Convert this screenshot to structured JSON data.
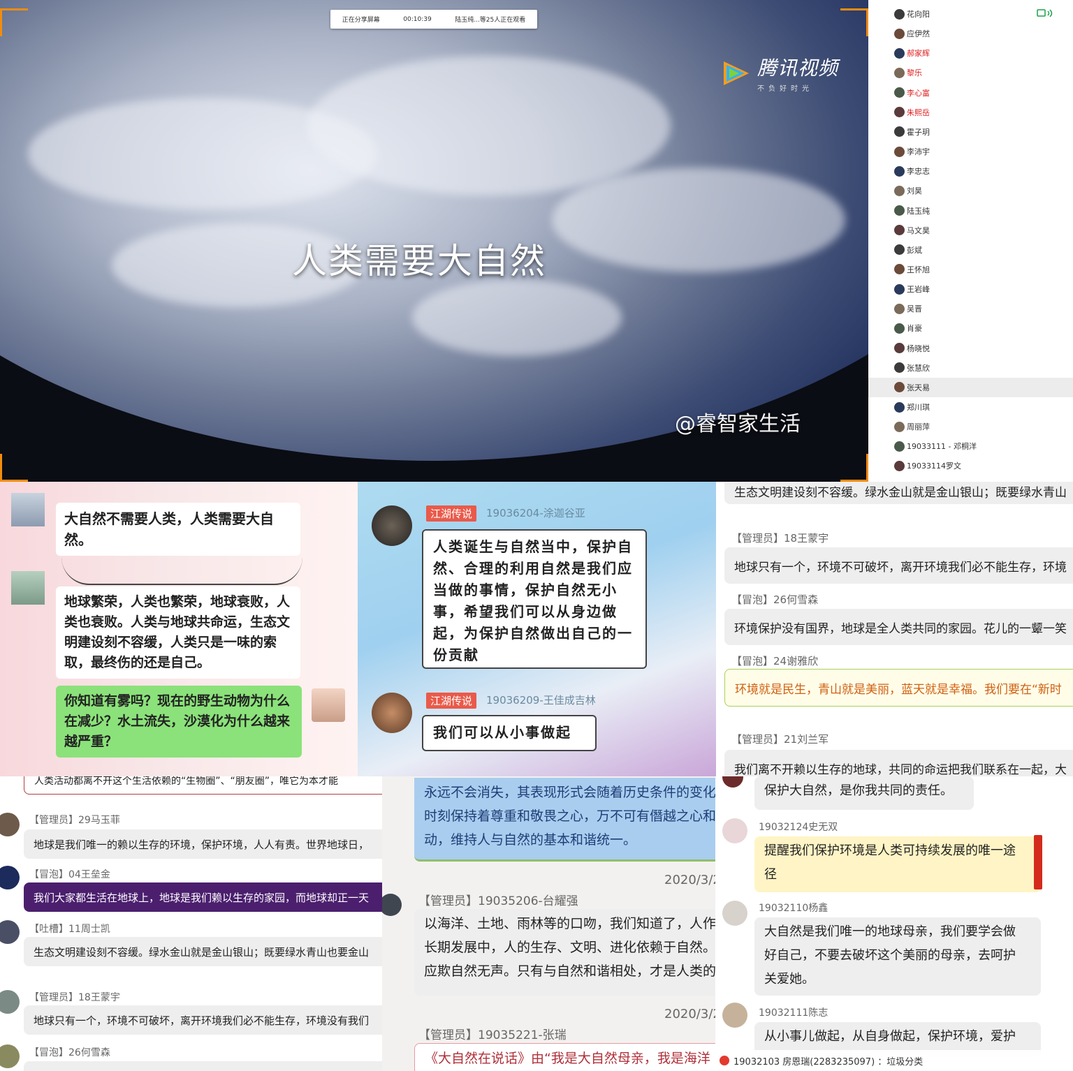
{
  "video": {
    "share_status": "正在分享屏幕",
    "share_time": "00:10:39",
    "viewers": "陆玉纯...等25人正在观看",
    "logo_text": "腾讯视频",
    "logo_slogan": "不负好时光",
    "caption": "人类需要大自然",
    "watermark": "@睿智家生活"
  },
  "members": {
    "items": [
      {
        "name": "花向阳",
        "color": "#333333"
      },
      {
        "name": "应伊然",
        "color": "#333333"
      },
      {
        "name": "郝家辉",
        "color": "#e02020"
      },
      {
        "name": "黎乐",
        "color": "#e02020"
      },
      {
        "name": "李心富",
        "color": "#e02020"
      },
      {
        "name": "朱熙岳",
        "color": "#e02020"
      },
      {
        "name": "霍子玥",
        "color": "#333333"
      },
      {
        "name": "李沛宇",
        "color": "#333333"
      },
      {
        "name": "李忠志",
        "color": "#333333"
      },
      {
        "name": "刘昊",
        "color": "#333333"
      },
      {
        "name": "陆玉纯",
        "color": "#333333"
      },
      {
        "name": "马文昊",
        "color": "#333333"
      },
      {
        "name": "彭斌",
        "color": "#333333"
      },
      {
        "name": "王怀旭",
        "color": "#333333"
      },
      {
        "name": "王岩峰",
        "color": "#333333"
      },
      {
        "name": "吴晋",
        "color": "#333333"
      },
      {
        "name": "肖豪",
        "color": "#333333"
      },
      {
        "name": "杨晓悦",
        "color": "#333333"
      },
      {
        "name": "张慧欣",
        "color": "#333333"
      },
      {
        "name": "张天易",
        "color": "#333333"
      },
      {
        "name": "郑川琪",
        "color": "#333333"
      },
      {
        "name": "周丽萍",
        "color": "#333333"
      },
      {
        "name": "19033111 - 邓桐洋",
        "color": "#333333"
      },
      {
        "name": "19033114罗文",
        "color": "#333333"
      }
    ]
  },
  "wechat": {
    "msg1": "大自然不需要人类，人类需要大自然。",
    "msg2": "地球繁荣，人类也繁荣，地球衰败，人类也衰败。人类与地球共命运，生态文明建设刻不容缓，人类只是一味的索取，最终伤的还是自己。",
    "msg3": "你知道有雾吗？现在的野生动物为什么在减少？水土流失，沙漠化为什么越来越严重？"
  },
  "comic": {
    "tag1": "江湖传说",
    "name1": "19036204-涂迦谷亚",
    "msg1": "人类诞生与自然当中，保护自然、合理的利用自然是我们应当做的事情，保护自然无小事，希望我们可以从身边做起，为保护自然做出自己的一份贡献",
    "tag2": "江湖传说",
    "name2": "19036209-王佳成吉林",
    "msg2": "我们可以从小事做起"
  },
  "p3": {
    "top_text": "生态文明建设刻不容缓。绿水金山就是金山银山；既要绿水青山",
    "items": [
      {
        "tag": "【管理员】18王蒙宇",
        "text": "地球只有一个，环境不可破坏，离开环境我们必不能生存，环境"
      },
      {
        "tag": "【冒泡】26何雪森",
        "text": "环境保护没有国界，地球是全人类共同的家园。花儿的一颦一笑"
      },
      {
        "tag": "【冒泡】24谢雅欣",
        "text": "环境就是民生，青山就是美丽，蓝天就是幸福。我们要在“新时"
      },
      {
        "tag": "【管理员】21刘兰军",
        "text": "我们离不开赖以生存的地球，共同的命运把我们联系在一起，大"
      }
    ]
  },
  "p4": {
    "top_text": "人类活动都离不开这个生活依赖的“生物圈”、“朋友圈”，唯它为本才能",
    "items": [
      {
        "tag": "【管理员】29马玉菲",
        "text": "地球是我们唯一的赖以生存的环境，保护环境，人人有责。世界地球日，"
      },
      {
        "tag": "【冒泡】04王垒金",
        "text": "我们大家都生活在地球上，地球是我们赖以生存的家园，而地球却正一天"
      },
      {
        "tag": "【吐槽】11周士凯",
        "text": "生态文明建设刻不容缓。绿水金山就是金山银山；既要绿水青山也要金山"
      },
      {
        "tag": "【管理员】18王蒙宇",
        "text": "地球只有一个，环境不可破坏，离开环境我们必不能生存，环境没有我们"
      },
      {
        "tag": "【冒泡】26何雪森",
        "text": ""
      }
    ]
  },
  "p5": {
    "top_lines": [
      "永远不会消失，其表现形式会随着历史条件的变化",
      "时刻保持着尊重和敬畏之心，万不可有僭越之心和",
      "动，维持人与自然的基本和谐统一。"
    ],
    "date1": "2020/3/2",
    "tag1": "【管理员】19035206-台耀强",
    "lines1": [
      "以海洋、土地、雨林等的口吻，我们知道了，人作",
      "长期发展中，人的生存、文明、进化依赖于自然。",
      "应欺自然无声。只有与自然和谐相处，才是人类的"
    ],
    "date2": "2020/3/2",
    "tag2": "【管理员】19035221-张瑞",
    "line2": "《大自然在说话》由“我是大自然母亲，我是海洋"
  },
  "p6": {
    "msg0": "保护大自然，是你我共同的责任。",
    "name1": "19032124史无双",
    "msg1_lines": [
      "提醒我们保护环境是人类可持续发展的唯一途",
      "径"
    ],
    "name2": "19032110杨鑫",
    "msg2_lines": [
      "大自然是我们唯一的地球母亲，我们要学会做",
      "好自己，不要去破坏这个美丽的母亲，去呵护",
      "关爱她。"
    ],
    "name3": "19032111陈志",
    "msg3": "从小事儿做起，从自身做起，保护环境，爱护",
    "footer": "19032103  房恩瑞(2283235097) ：垃圾分类"
  }
}
